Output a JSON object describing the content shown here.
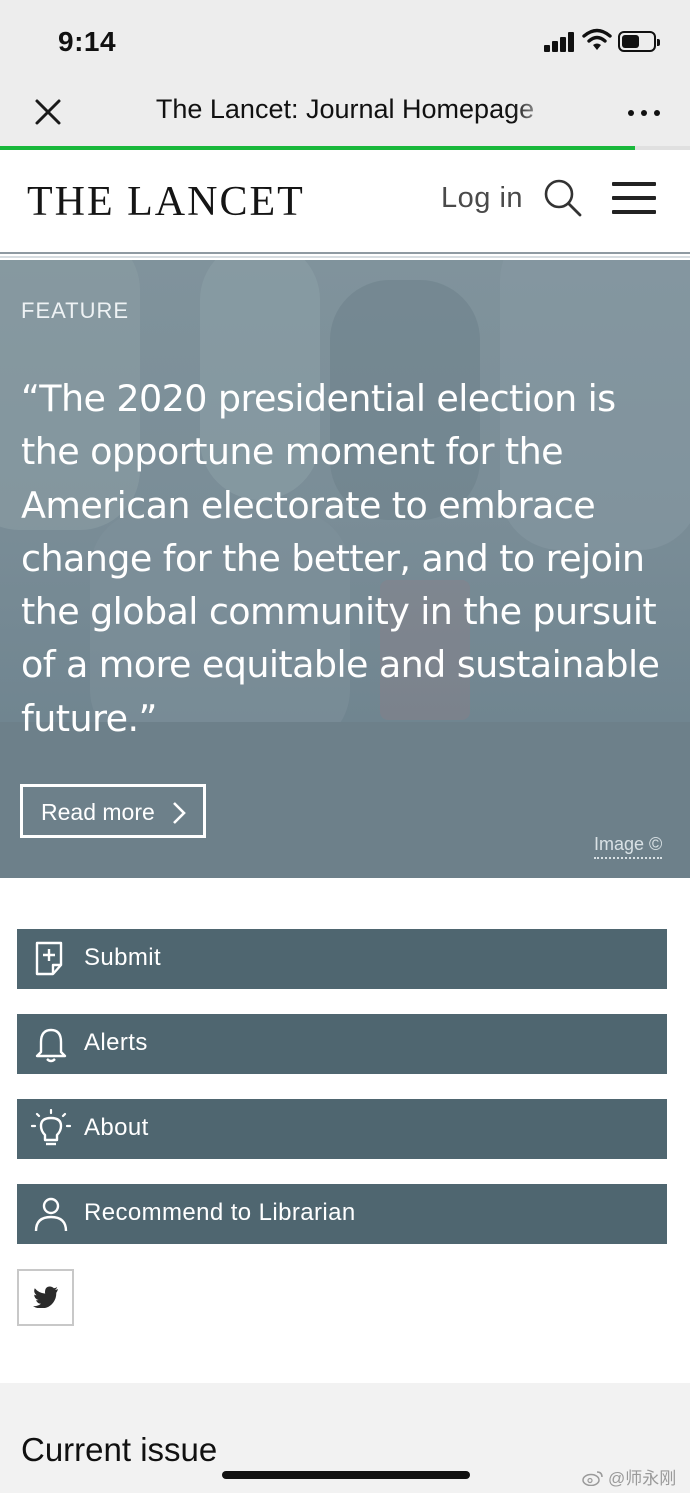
{
  "status_bar": {
    "time": "9:14"
  },
  "browser": {
    "title": "The Lancet: Journal Homepage",
    "load_progress": 0.92
  },
  "header": {
    "logo": "THE LANCET",
    "login_label": "Log in"
  },
  "hero": {
    "category": "FEATURE",
    "quote": "“The 2020 presidential election is the opportune moment for the American electorate to embrace change for the better, and to rejoin the global community in the pursuit of a more equitable and sustainable future.”",
    "read_more_label": "Read more",
    "image_credit": "Image ©"
  },
  "actions": [
    {
      "label": "Submit",
      "icon": "submit-document-icon"
    },
    {
      "label": "Alerts",
      "icon": "bell-icon"
    },
    {
      "label": "About",
      "icon": "lightbulb-icon"
    },
    {
      "label": "Recommend to Librarian",
      "icon": "person-icon"
    }
  ],
  "social": {
    "twitter_icon": "twitter-bird-icon"
  },
  "current_issue": {
    "title": "Current issue"
  },
  "watermark": {
    "text": "@师永刚"
  },
  "colors": {
    "action_button": "#4f6670",
    "hero_overlay": "#6d808a",
    "progress": "#19b83b"
  }
}
